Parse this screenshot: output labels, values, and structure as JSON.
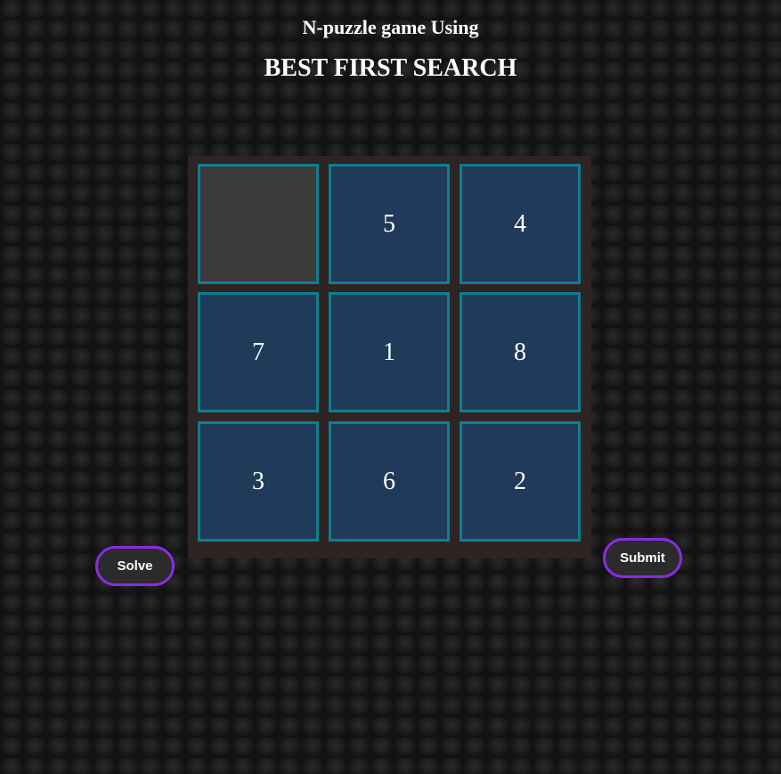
{
  "header": {
    "subtitle": "N-puzzle game Using",
    "title": "BEST FIRST SEARCH"
  },
  "board": {
    "rows": 3,
    "cols": 3,
    "tiles": [
      "",
      "5",
      "4",
      "7",
      "1",
      "8",
      "3",
      "6",
      "2"
    ]
  },
  "buttons": {
    "solve_label": "Solve",
    "submit_label": "Submit"
  },
  "colors": {
    "tile": "#203a59",
    "tile_border": "#0e7f8f",
    "empty_tile": "#3b3b3b",
    "board_bg": "#2e2424",
    "button_border": "#8a2be2",
    "button_bg": "#2b2b2b"
  }
}
